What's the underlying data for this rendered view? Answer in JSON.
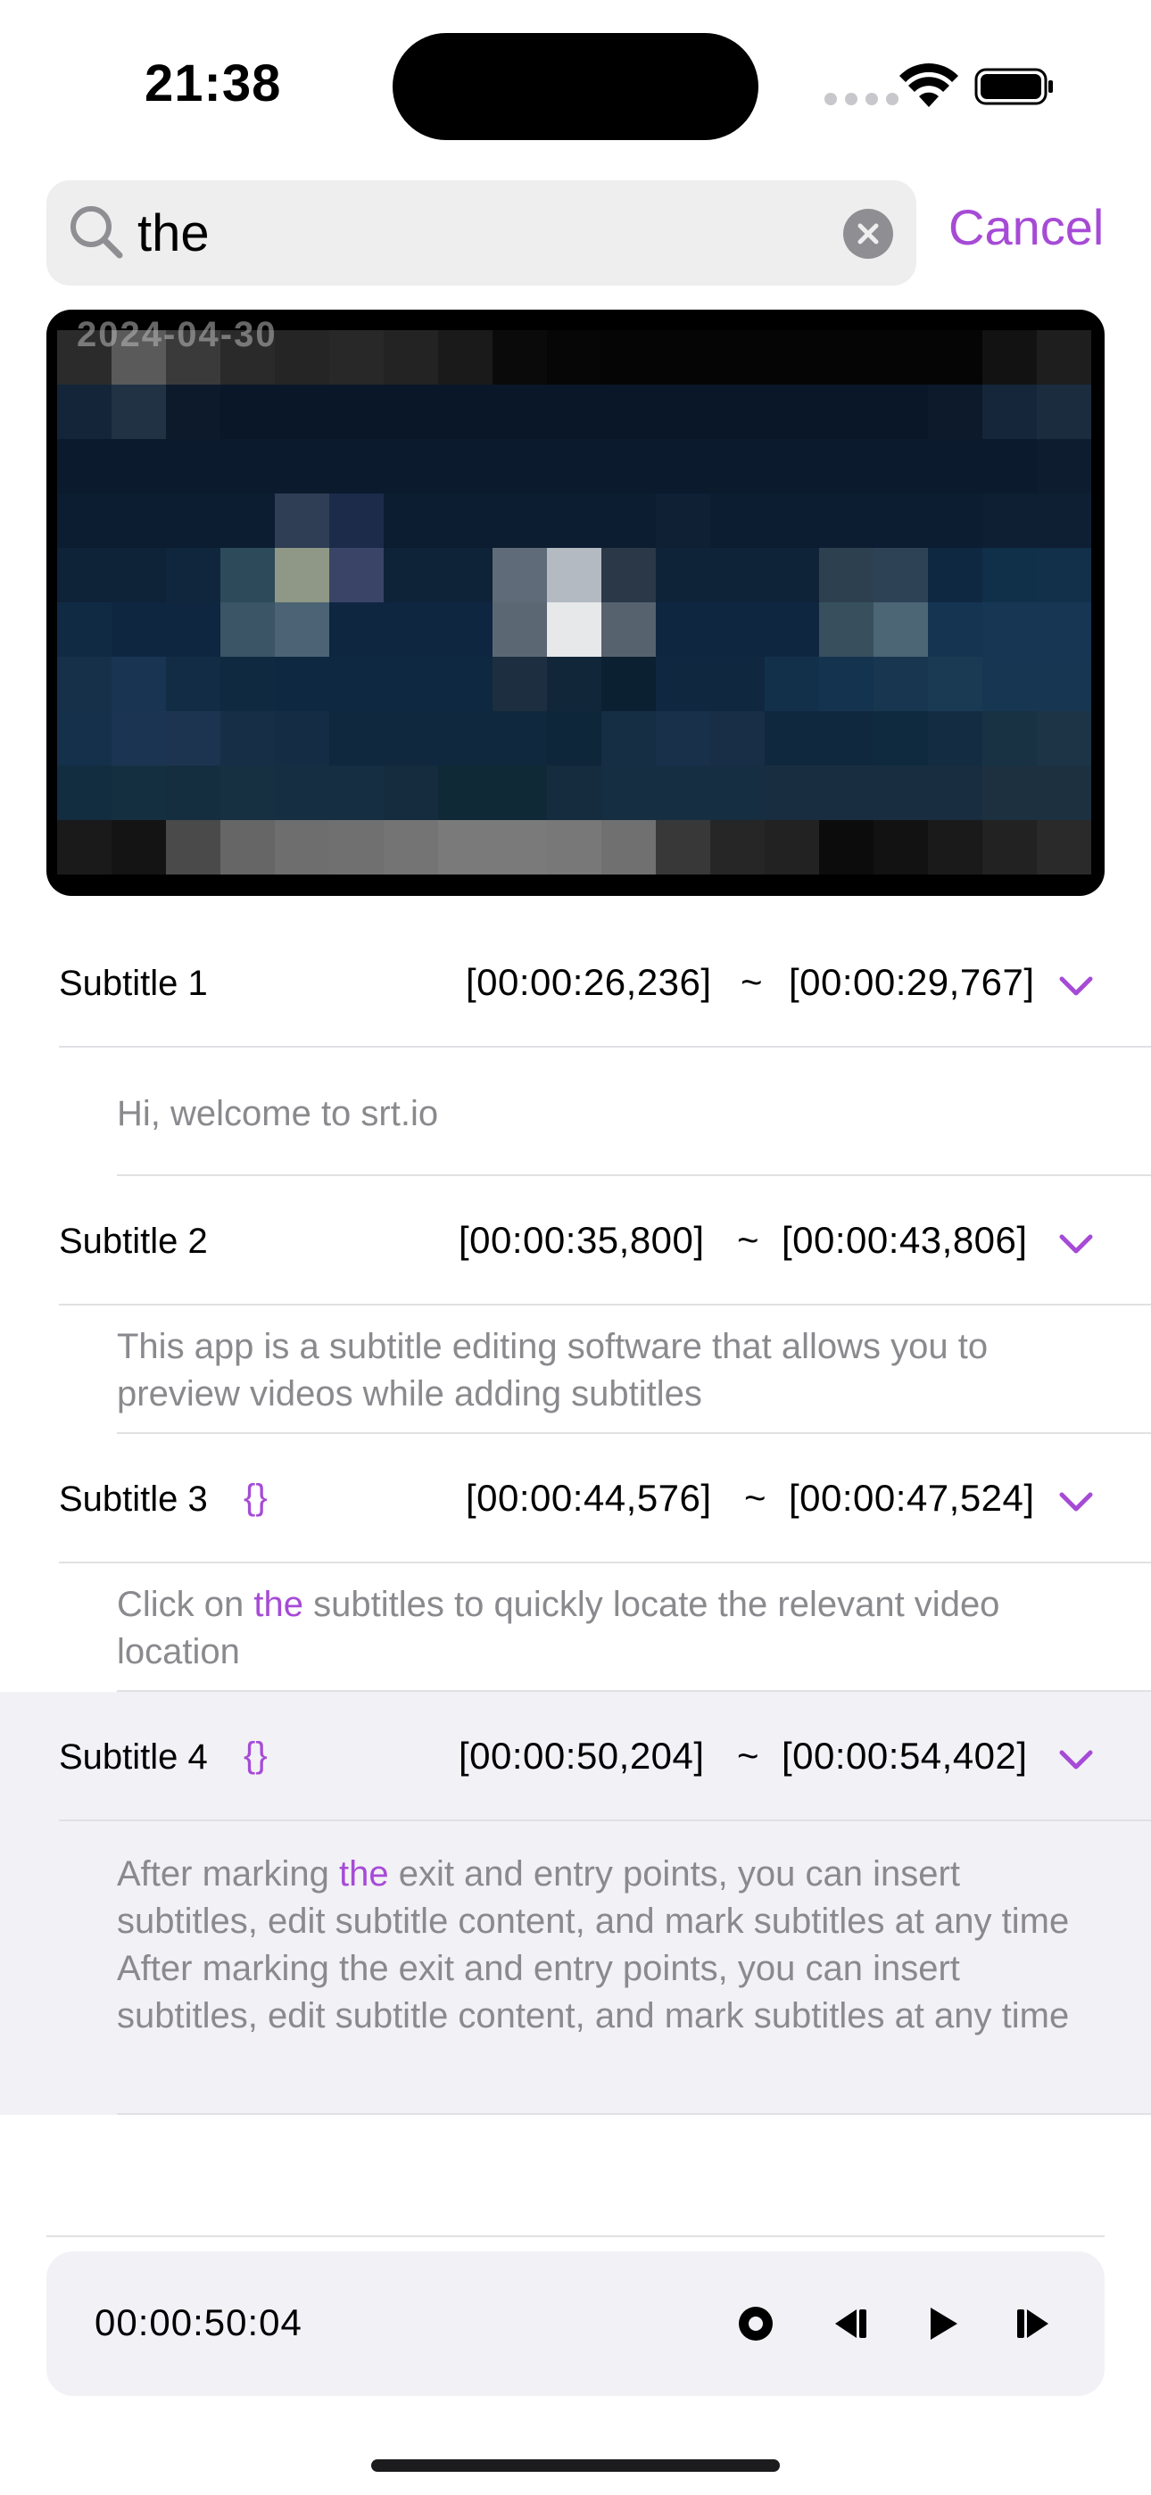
{
  "status_bar": {
    "time": "21:38"
  },
  "search": {
    "value": "the",
    "cancel_label": "Cancel"
  },
  "video": {
    "overlay_text": "2024-04-30"
  },
  "subtitles": [
    {
      "title": "Subtitle 1",
      "start": "[00:00:26,236]",
      "end": "[00:00:29,767]",
      "separator": "~",
      "has_brace": false,
      "text_parts": [
        "Hi, welcome to srt.io"
      ]
    },
    {
      "title": "Subtitle 2",
      "start": "[00:00:35,800]",
      "end": "[00:00:43,806]",
      "separator": "~",
      "has_brace": false,
      "text_parts": [
        "This app is a subtitle editing software that allows you to preview videos while adding subtitles"
      ]
    },
    {
      "title": "Subtitle 3",
      "start": "[00:00:44,576]",
      "end": "[00:00:47,524]",
      "separator": "~",
      "has_brace": true,
      "brace": "{}",
      "text_before": "Click on ",
      "match": "the",
      "text_after": " subtitles to quickly locate the relevant video location"
    },
    {
      "title": "Subtitle 4",
      "start": "[00:00:50,204]",
      "end": "[00:00:54,402]",
      "separator": "~",
      "has_brace": true,
      "brace": "{}",
      "selected": true,
      "text_before": "After marking ",
      "match": "the",
      "text_after": " exit and entry points, you can insert subtitles, edit subtitle content, and mark subtitles at any time After marking the exit and entry points, you can insert subtitles, edit subtitle content, and mark subtitles at any time"
    }
  ],
  "playback": {
    "time": "00:00:50:04"
  },
  "icons": {
    "search": "search-icon",
    "clear": "clear-icon",
    "chevron": "chevron-down-icon",
    "record": "record-icon",
    "step_back": "step-backward-icon",
    "play": "play-icon",
    "step_forward": "step-forward-icon"
  },
  "colors": {
    "accent": "#a64bd6",
    "selected_row": "#f2f1f6",
    "secondary_text": "#8a8a8e"
  }
}
